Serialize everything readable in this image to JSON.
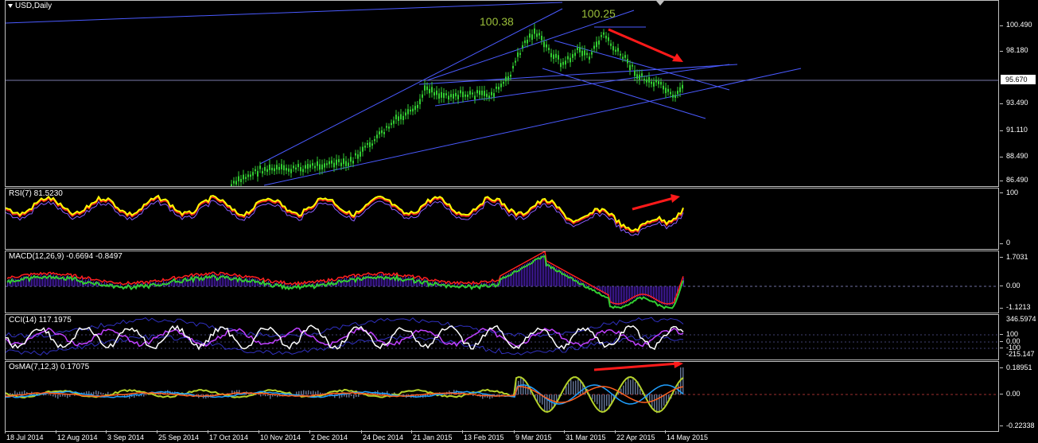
{
  "window": {
    "symbol_label": "USD,Daily"
  },
  "price_pane": {
    "annotations": {
      "high1": "100.38",
      "high2": "100.25"
    },
    "axis_labels": [
      "100.490",
      "98.180",
      "95.670",
      "93.490",
      "91.110",
      "88.490",
      "86.490"
    ],
    "current_price": "95.670",
    "ylim": [
      86.0,
      101.5
    ]
  },
  "rsi_pane": {
    "title": "RSI(7) 81.5230",
    "axis_labels": [
      "100",
      "0"
    ]
  },
  "macd_pane": {
    "title": "MACD(12,26,9) -0.6694 -0.8497",
    "axis_labels": [
      "1.7031",
      "0.00",
      "-1.1213"
    ]
  },
  "cci_pane": {
    "title": "CCI(14) 117.1975",
    "axis_labels": [
      "346.5974",
      "100",
      "0.00",
      "-100",
      "-215.147"
    ]
  },
  "osma_pane": {
    "title": "OsMA(7,12,3) 0.17075",
    "axis_labels": [
      "0.18951",
      "0.00",
      "-0.22338"
    ]
  },
  "time_axis": [
    "18 Jul 2014",
    "12 Aug 2014",
    "3 Sep 2014",
    "25 Sep 2014",
    "17 Oct 2014",
    "10 Nov 2014",
    "2 Dec 2014",
    "24 Dec 2014",
    "21 Jan 2015",
    "13 Feb 2015",
    "9 Mar 2015",
    "31 Mar 2015",
    "22 Apr 2015",
    "14 May 2015"
  ],
  "colors": {
    "background": "#000000",
    "candle": "#32cd32",
    "trendline": "#4a5aff",
    "arrow": "#ff1a1a",
    "rsi_main": "#ffff00",
    "rsi_signal": "#ff2020",
    "macd_hist": "#5020c0",
    "macd_line": "#32cd32",
    "annotation": "#9bbf3a"
  }
}
